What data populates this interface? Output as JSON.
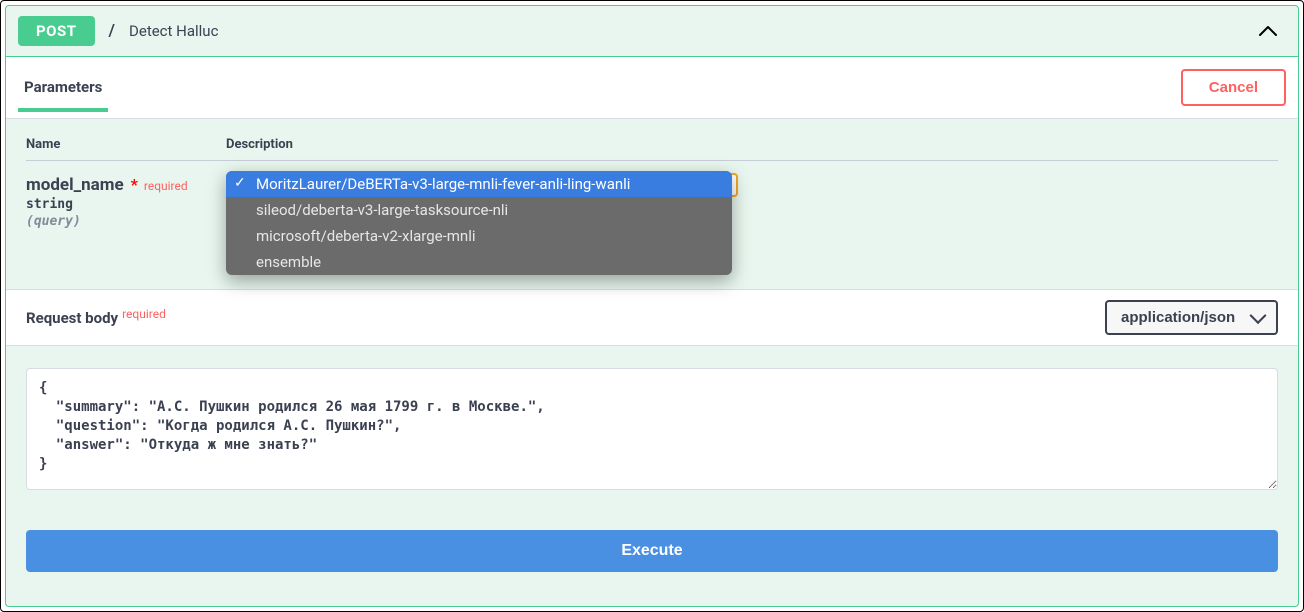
{
  "header": {
    "method": "POST",
    "path_separator": "/",
    "summary": "Detect Halluc"
  },
  "tabs": {
    "parameters_label": "Parameters",
    "cancel_label": "Cancel"
  },
  "params_table": {
    "name_header": "Name",
    "desc_header": "Description"
  },
  "param": {
    "name": "model_name",
    "required_star": "*",
    "required_label": "required",
    "type": "string",
    "in": "(query)",
    "options": [
      "MoritzLaurer/DeBERTa-v3-large-mnli-fever-anli-ling-wanli",
      "sileod/deberta-v3-large-tasksource-nli",
      "microsoft/deberta-v2-xlarge-mnli",
      "ensemble"
    ],
    "selected_index": 0
  },
  "body": {
    "title": "Request body",
    "required_label": "required",
    "content_type": "application/json",
    "value": "{\n  \"summary\": \"А.С. Пушкин родился 26 мая 1799 г. в Москве.\",\n  \"question\": \"Когда родился А.С. Пушкин?\",\n  \"answer\": \"Откуда ж мне знать?\"\n}"
  },
  "actions": {
    "execute_label": "Execute"
  }
}
